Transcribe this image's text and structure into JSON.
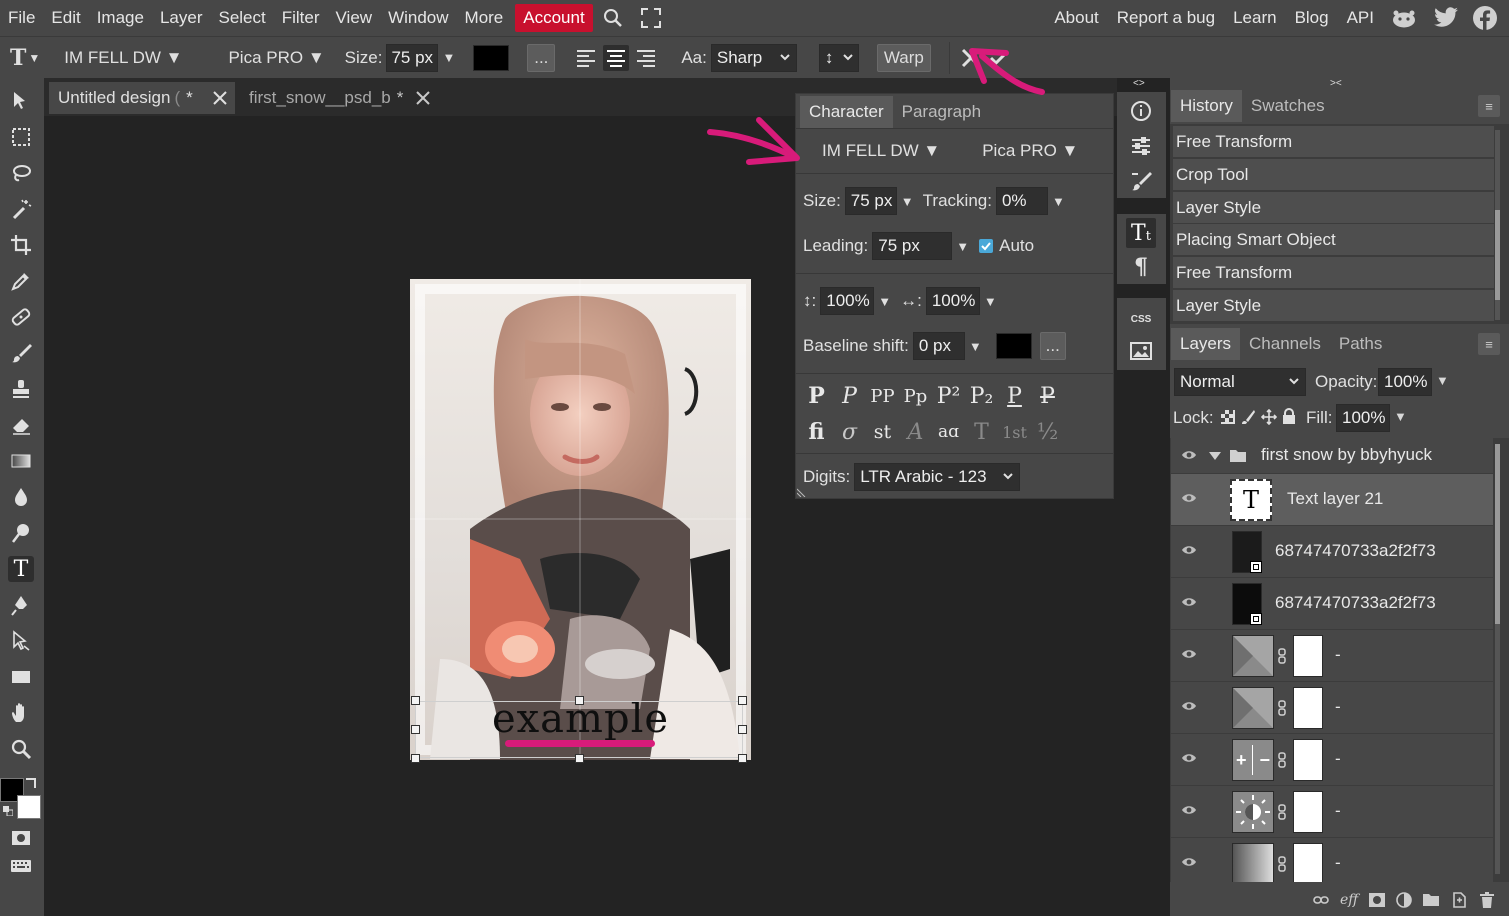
{
  "menubar": {
    "items": [
      "File",
      "Edit",
      "Image",
      "Layer",
      "Select",
      "Filter",
      "View",
      "Window",
      "More"
    ],
    "account": "Account",
    "links": [
      "About",
      "Report a bug",
      "Learn",
      "Blog",
      "API"
    ]
  },
  "options": {
    "font": "IM FELL DW ▼",
    "font_style": "Pica PRO ▼",
    "size_label": "Size:",
    "size_value": "75 px",
    "more": "...",
    "aa_label": "Aa:",
    "aa_value": "Sharp",
    "orient": "↕",
    "warp": "Warp"
  },
  "tabs": [
    {
      "title": "Untitled design",
      "suffix": "(",
      "mod": "*"
    },
    {
      "title": "first_snow__psd_b",
      "mod": "*"
    }
  ],
  "canvas_text": "example",
  "character": {
    "tabs": [
      "Character",
      "Paragraph"
    ],
    "font": "IM FELL DW ▼",
    "font_style": "Pica PRO ▼",
    "size_label": "Size:",
    "size_value": "75 px",
    "tracking_label": "Tracking:",
    "tracking_value": "0%",
    "leading_label": "Leading:",
    "leading_value": "75 px",
    "auto_label": "Auto",
    "vscale_label": "↕:",
    "vscale_value": "100%",
    "hscale_label": "↔:",
    "hscale_value": "100%",
    "baseline_label": "Baseline shift:",
    "baseline_value": "0 px",
    "more": "...",
    "glyphs_row1": [
      "P",
      "P",
      "PP",
      "Pp",
      "P²",
      "P₂",
      "P",
      "P"
    ],
    "glyphs_row2": [
      "fi",
      "σ",
      "st",
      "A",
      "aɑ",
      "T",
      "1st",
      "½"
    ],
    "digits_label": "Digits:",
    "digits_value": "LTR Arabic - 123"
  },
  "strip": {
    "css": "CSS"
  },
  "history": {
    "tabs": [
      "History",
      "Swatches"
    ],
    "items": [
      "Free Transform",
      "Crop Tool",
      "Layer Style",
      "Placing Smart Object",
      "Free Transform",
      "Layer Style"
    ]
  },
  "layers": {
    "tabs": [
      "Layers",
      "Channels",
      "Paths"
    ],
    "blend": "Normal",
    "opacity_label": "Opacity:",
    "opacity_value": "100%",
    "lock_label": "Lock:",
    "fill_label": "Fill:",
    "fill_value": "100%",
    "group_name": "first snow by bbyhyuck",
    "text_layer": "Text layer 21",
    "text_thumb": "T",
    "smart1": "68747470733a2f2f73",
    "smart2": "68747470733a2f2f73",
    "adj_names": [
      "-",
      "-",
      "-",
      "-",
      "-"
    ]
  },
  "colors": {
    "accent": "#c8102e",
    "annotation": "#d81b7a"
  }
}
